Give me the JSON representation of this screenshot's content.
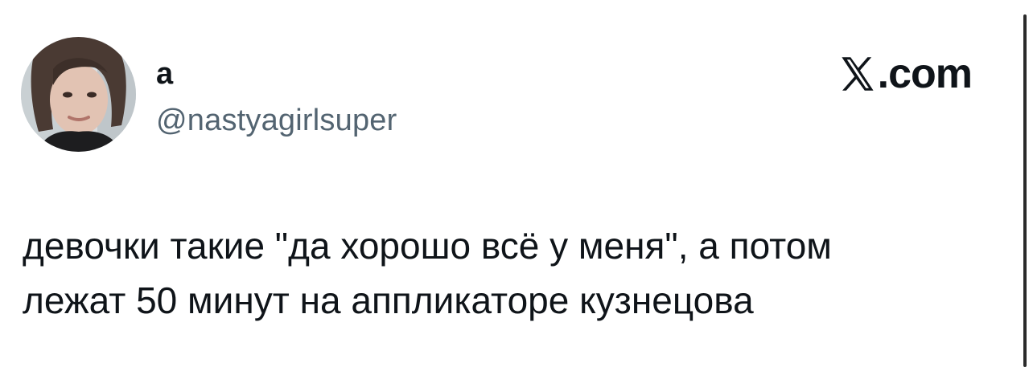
{
  "tweet": {
    "author": {
      "display_name": "а",
      "handle": "@nastyagirlsuper",
      "avatar_icon": "profile-photo"
    },
    "brand": {
      "logo_icon": "x-logo-icon",
      "suffix": ".com"
    },
    "text_lines": [
      "девочки такие \"да хорошо всё у меня\", а потом",
      "лежат 50 минут на аппликаторе кузнецова"
    ]
  },
  "colors": {
    "text_primary": "#0f1419",
    "text_secondary": "#536471",
    "background": "#ffffff"
  }
}
